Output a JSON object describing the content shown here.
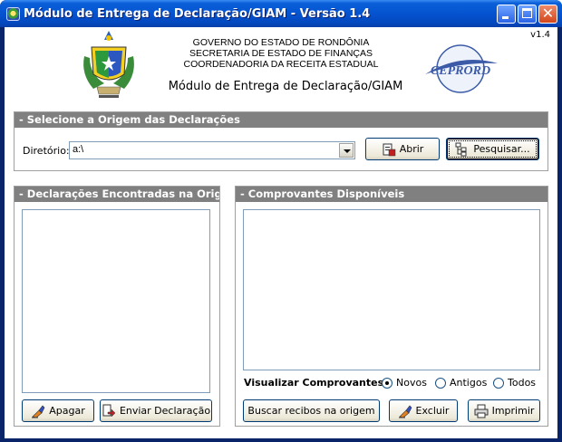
{
  "window": {
    "title": "Módulo de Entrega de Declaração/GIAM - Versão 1.4",
    "icons": {
      "minimize": "minimize-icon",
      "maximize": "maximize-icon",
      "close": "close-icon"
    }
  },
  "header": {
    "version": "v1.4",
    "line1": "GOVERNO DO ESTADO DE RONDÔNIA",
    "line2": "SECRETARIA DE ESTADO DE FINANÇAS",
    "line3": "COORDENADORIA DA RECEITA ESTADUAL",
    "module_title": "Módulo de Entrega de Declaração/GIAM",
    "partner_logo": "CEPRORD"
  },
  "origin": {
    "heading": "- Selecione a Origem das Declarações",
    "dir_label": "Diretório:",
    "dir_value": "a:\\",
    "open_button": "Abrir",
    "search_button": "Pesquisar..."
  },
  "found": {
    "heading": "- Declarações Encontradas na Origem",
    "items": [],
    "delete_button": "Apagar",
    "send_button": "Enviar Declaração"
  },
  "receipts": {
    "heading": "- Comprovantes Disponíveis",
    "items": [],
    "view_label": "Visualizar Comprovantes:",
    "options": [
      "Novos",
      "Antigos",
      "Todos"
    ],
    "selected": "Novos",
    "fetch_button": "Buscar recibos na origem",
    "delete_button": "Excluir",
    "print_button": "Imprimir"
  },
  "colors": {
    "titlebar": "#0553d0",
    "group_header": "#808080",
    "button_face": "#ece9d8",
    "close_button": "#d2461c"
  }
}
